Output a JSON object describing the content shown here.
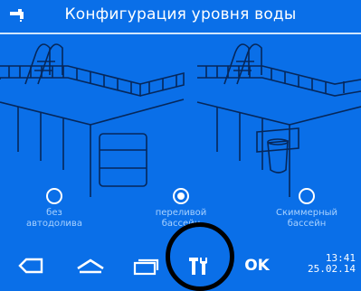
{
  "header": {
    "title": "Конфигурация уровня воды",
    "left_icon": "water-tap-icon"
  },
  "options": [
    {
      "label": "без\nавтодолива",
      "selected": false
    },
    {
      "label": "переливой\nбассейн",
      "selected": true
    },
    {
      "label": "Скиммерный\nбассейн",
      "selected": false
    }
  ],
  "toolbar": {
    "back_icon": "back-delete-icon",
    "home_icon": "home-roof-icon",
    "windows_icon": "windows-stack-icon",
    "tools_icon": "tools-icon",
    "ok_label": "OK",
    "time": "13:41",
    "date": "25.02.14"
  },
  "colors": {
    "background": "#0a6fe8",
    "foreground": "#ffffff",
    "muted_text": "#a9d2ff",
    "highlight_circle": "#000000"
  }
}
